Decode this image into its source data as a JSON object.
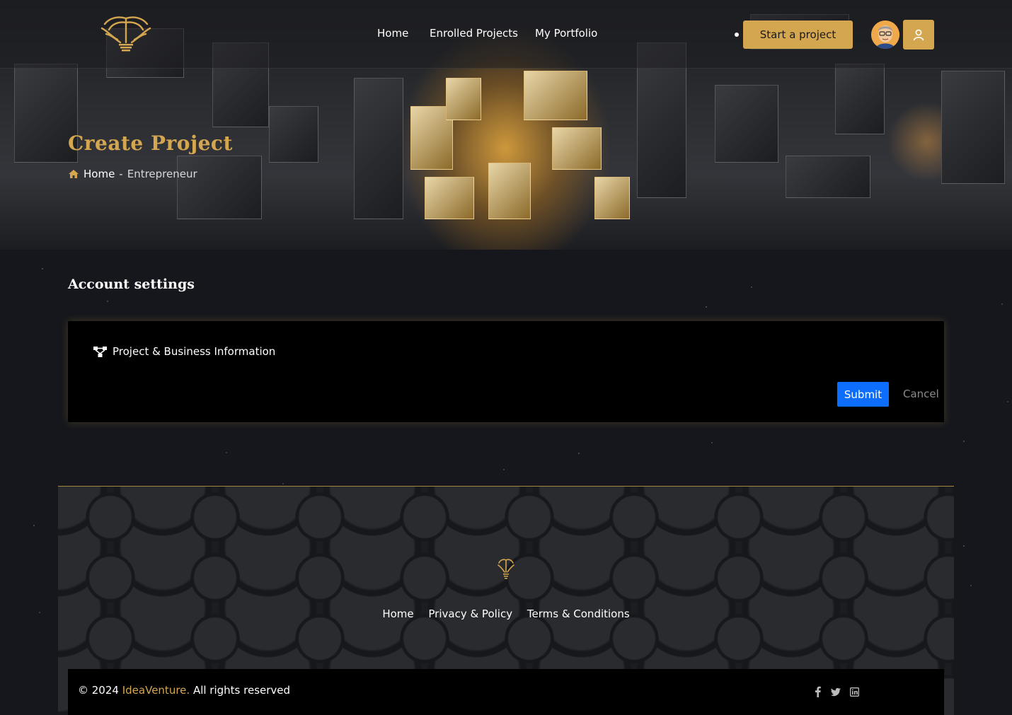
{
  "colors": {
    "accent": "#d4a650",
    "primary_button": "#0d6efd",
    "background": "#15171c"
  },
  "header": {
    "nav": [
      {
        "label": "Home"
      },
      {
        "label": "Enrolled Projects"
      },
      {
        "label": "My Portfolio"
      }
    ],
    "cta_label": "Start a project",
    "icons": {
      "logo": "brain-tree-logo",
      "avatar": "user-avatar",
      "account": "user-icon"
    }
  },
  "hero": {
    "title": "Create Project",
    "breadcrumb": {
      "home": "Home",
      "separator": "-",
      "current": "Entrepreneur",
      "icon": "home-icon"
    }
  },
  "main": {
    "section_title": "Account settings",
    "tabs": [
      {
        "label": "Project & Business Information",
        "icon": "sitemap-icon"
      }
    ],
    "submit_label": "Submit",
    "cancel_label": "Cancel"
  },
  "footer": {
    "links": [
      {
        "label": "Home"
      },
      {
        "label": "Privacy & Policy"
      },
      {
        "label": "Terms & Conditions"
      }
    ],
    "copyright_prefix": "© 2024",
    "brand": "IdeaVenture.",
    "copyright_suffix": "All rights reserved",
    "socials": [
      "facebook-icon",
      "twitter-icon",
      "linkedin-icon"
    ]
  }
}
